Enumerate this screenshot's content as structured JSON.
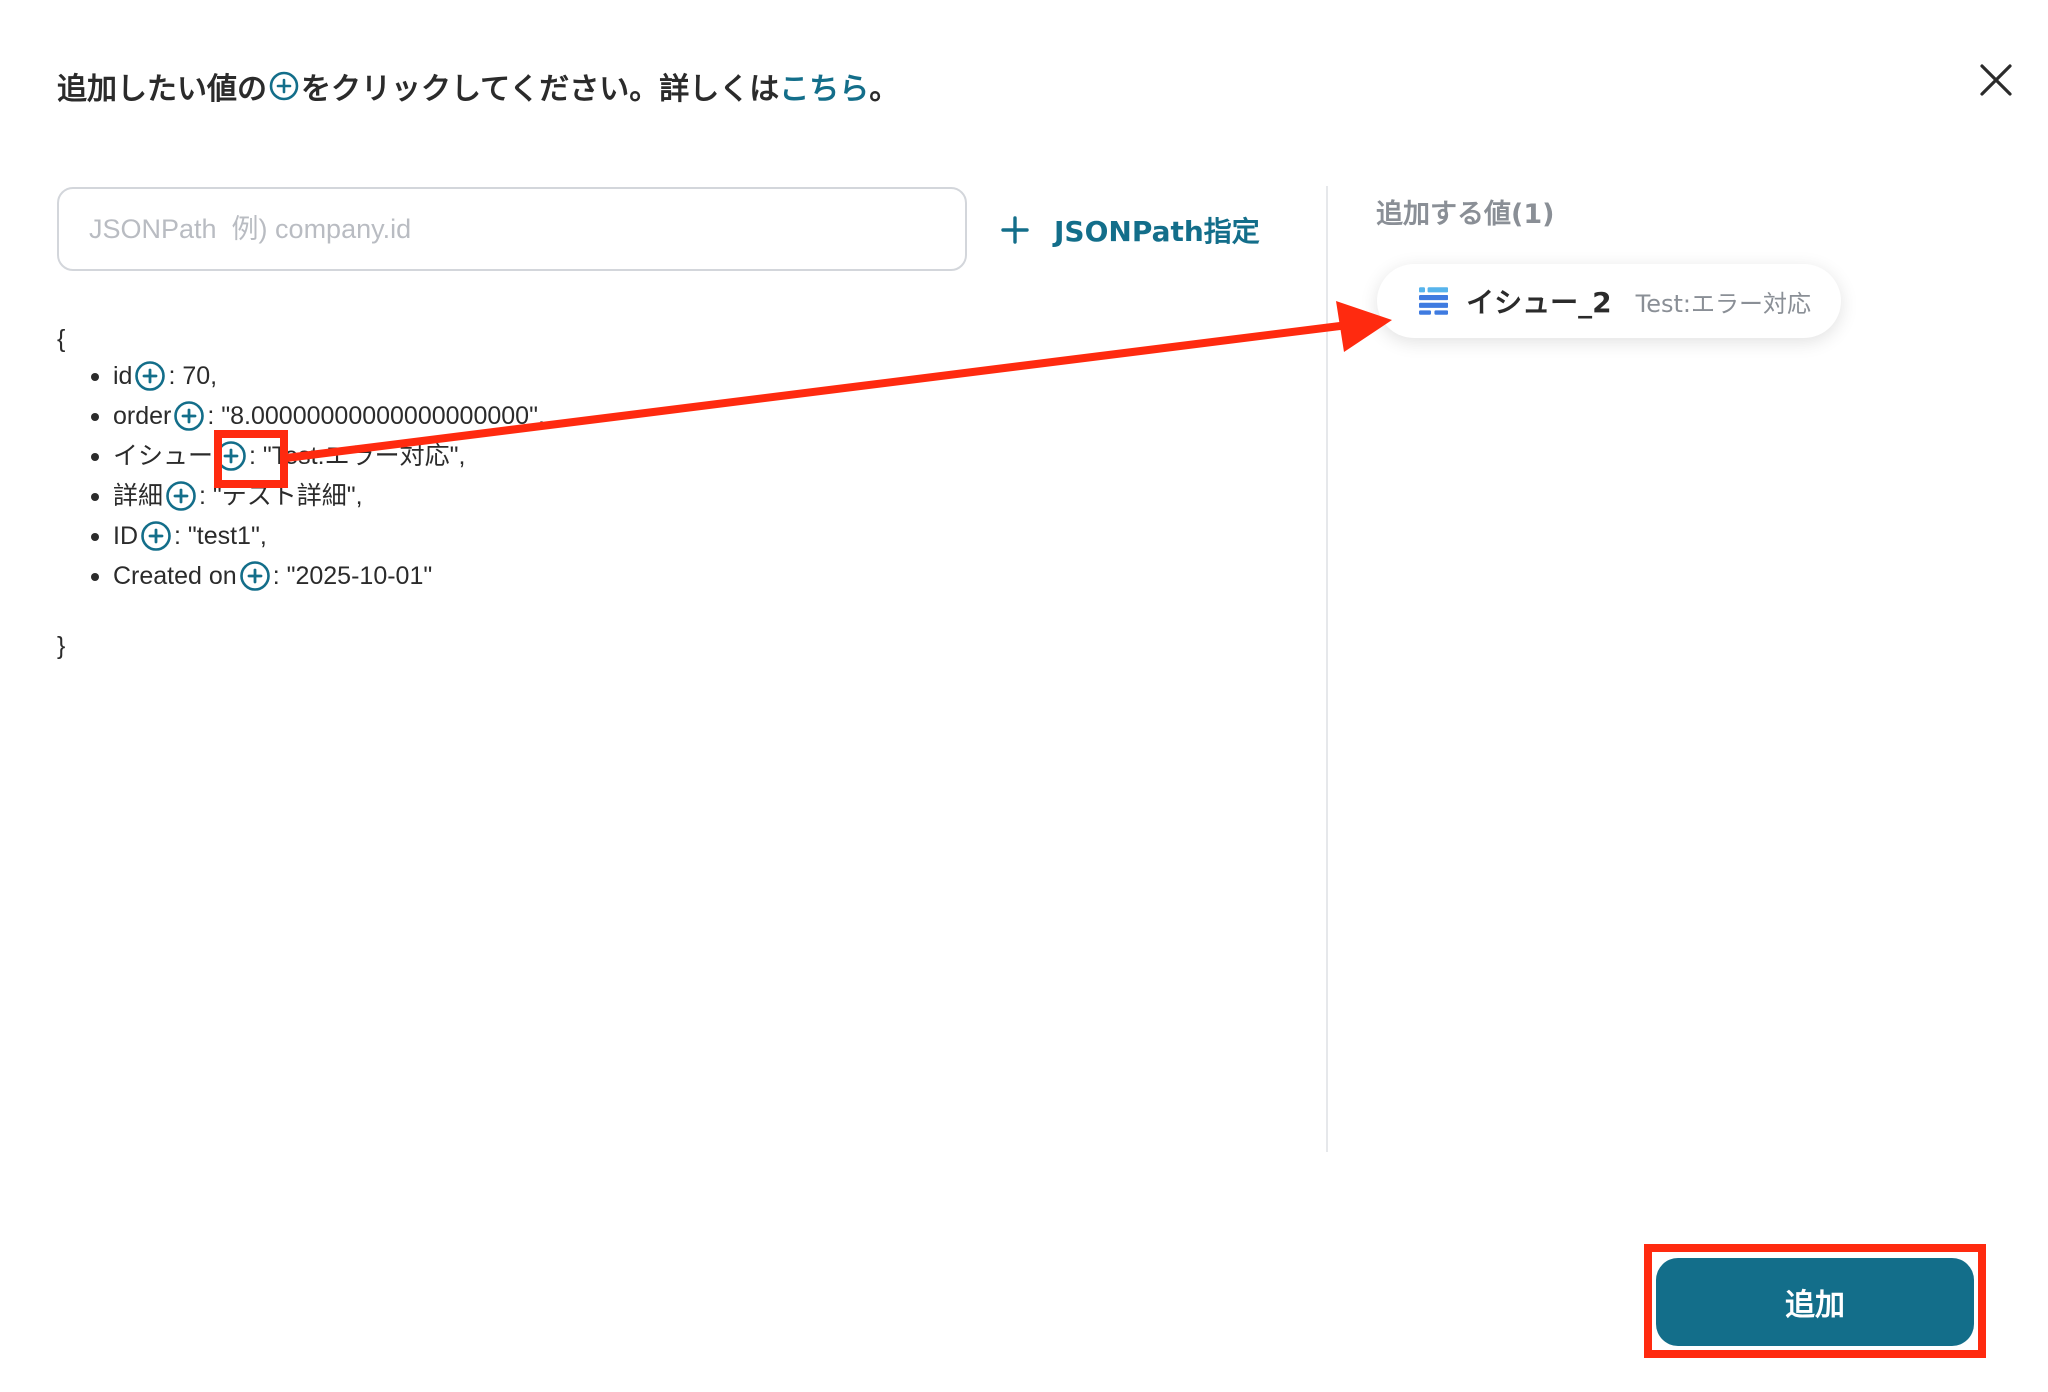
{
  "header": {
    "title_before_icon": "追加したい値の",
    "title_after_icon": "をクリックしてください。詳しくは",
    "link_label": "こちら",
    "title_end": "。"
  },
  "search": {
    "placeholder": "JSONPath  例) company.id",
    "value": ""
  },
  "jsonpath_button": {
    "label": "JSONPath指定"
  },
  "json": {
    "open_brace": "{",
    "close_brace": "}",
    "fields": [
      {
        "key": "id",
        "value": ": 70,"
      },
      {
        "key": "order",
        "value": ": \"8.00000000000000000000\","
      },
      {
        "key": "イシュー",
        "value": ": \"Test:エラー対応\","
      },
      {
        "key": "詳細",
        "value": ": \"テスト詳細\","
      },
      {
        "key": "ID",
        "value": ": \"test1\","
      },
      {
        "key": "Created on",
        "value": ": \"2025-10-01\""
      }
    ]
  },
  "added_values": {
    "heading": "追加する値(1)",
    "items": [
      {
        "name": "イシュー_2",
        "value": "Test:エラー対応",
        "icon": "table-rows-icon"
      }
    ]
  },
  "footer": {
    "add_label": "追加"
  },
  "colors": {
    "accent": "#136e8a",
    "annotation": "#ff2a0f",
    "chip_icon_blue": "#3f7be0",
    "chip_icon_light": "#57b4ec"
  }
}
